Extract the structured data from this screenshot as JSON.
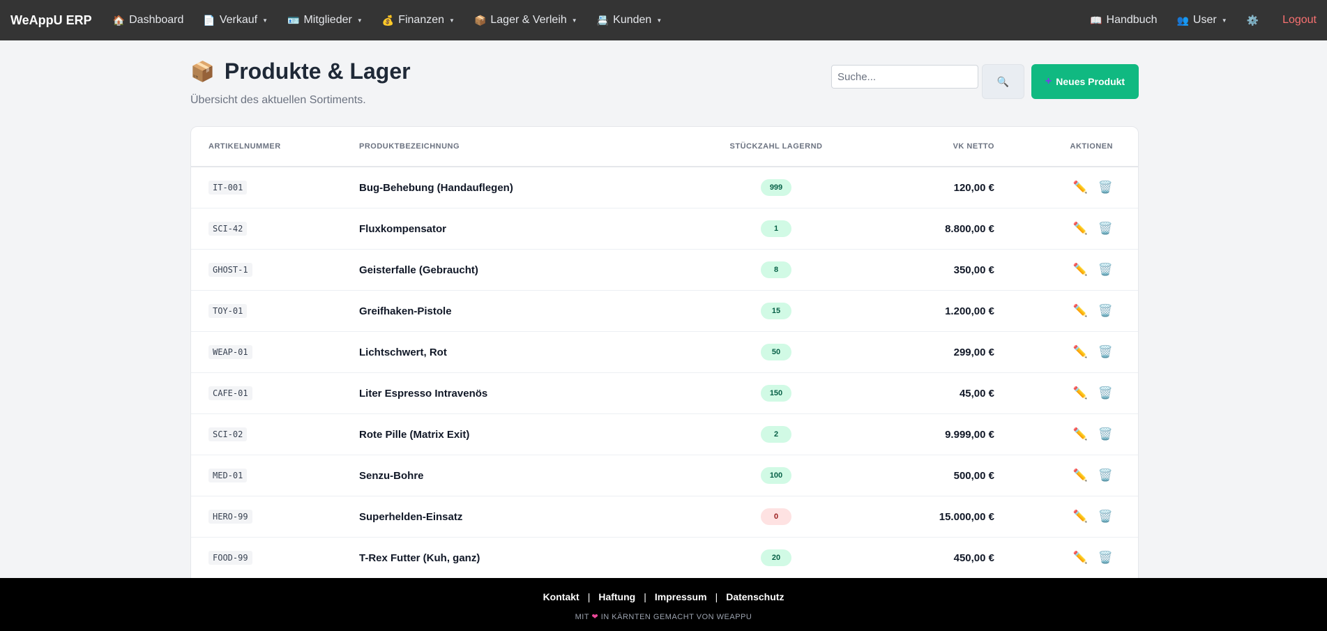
{
  "nav": {
    "brand": "WeAppU ERP",
    "items": [
      {
        "icon": "🏠",
        "label": "Dashboard",
        "dropdown": false
      },
      {
        "icon": "📄",
        "label": "Verkauf",
        "dropdown": true
      },
      {
        "icon": "🪪",
        "label": "Mitglieder",
        "dropdown": true
      },
      {
        "icon": "💰",
        "label": "Finanzen",
        "dropdown": true
      },
      {
        "icon": "📦",
        "label": "Lager & Verleih",
        "dropdown": true
      },
      {
        "icon": "📇",
        "label": "Kunden",
        "dropdown": true
      }
    ],
    "handbook": {
      "icon": "📖",
      "label": "Handbuch"
    },
    "user": {
      "icon": "👥",
      "label": "User"
    },
    "settings_icon": "⚙️",
    "logout": "Logout"
  },
  "page": {
    "icon": "📦",
    "title": "Produkte & Lager",
    "subtitle": "Übersicht des aktuellen Sortiments."
  },
  "search": {
    "placeholder": "Suche...",
    "value": "",
    "button_icon": "🔍"
  },
  "new_button": {
    "icon": "+",
    "label": "Neues Produkt"
  },
  "table": {
    "columns": {
      "sku": "ARTIKELNUMMER",
      "name": "PRODUKTBEZEICHNUNG",
      "qty": "STÜCKZAHL LAGERND",
      "price": "VK NETTO",
      "actions": "AKTIONEN"
    },
    "rows": [
      {
        "sku": "IT-001",
        "name": "Bug-Behebung (Handauflegen)",
        "qty": "999",
        "price": "120,00 €"
      },
      {
        "sku": "SCI-42",
        "name": "Fluxkompensator",
        "qty": "1",
        "price": "8.800,00 €"
      },
      {
        "sku": "GHOST-1",
        "name": "Geisterfalle (Gebraucht)",
        "qty": "8",
        "price": "350,00 €"
      },
      {
        "sku": "TOY-01",
        "name": "Greifhaken-Pistole",
        "qty": "15",
        "price": "1.200,00 €"
      },
      {
        "sku": "WEAP-01",
        "name": "Lichtschwert, Rot",
        "qty": "50",
        "price": "299,00 €"
      },
      {
        "sku": "CAFE-01",
        "name": "Liter Espresso Intravenös",
        "qty": "150",
        "price": "45,00 €"
      },
      {
        "sku": "SCI-02",
        "name": "Rote Pille (Matrix Exit)",
        "qty": "2",
        "price": "9.999,00 €"
      },
      {
        "sku": "MED-01",
        "name": "Senzu-Bohre",
        "qty": "100",
        "price": "500,00 €"
      },
      {
        "sku": "HERO-99",
        "name": "Superhelden-Einsatz",
        "qty": "0",
        "price": "15.000,00 €"
      },
      {
        "sku": "FOOD-99",
        "name": "T-Rex Futter (Kuh, ganz)",
        "qty": "20",
        "price": "450,00 €"
      }
    ],
    "edit_icon": "✏️",
    "delete_icon": "🗑️"
  },
  "footer": {
    "links": [
      "Kontakt",
      "Haftung",
      "Impressum",
      "Datenschutz"
    ],
    "separator": "|",
    "note_prefix": "MIT",
    "heart": "❤",
    "note_suffix": "IN KÄRNTEN GEMACHT VON WEAPPU"
  },
  "colors": {
    "nav_bg": "#343434",
    "accent_green": "#10b981",
    "logout_red": "#f87171",
    "qty_ok_bg": "#d1fae5",
    "qty_zero_bg": "#fee2e2",
    "footer_bg": "#000000"
  }
}
